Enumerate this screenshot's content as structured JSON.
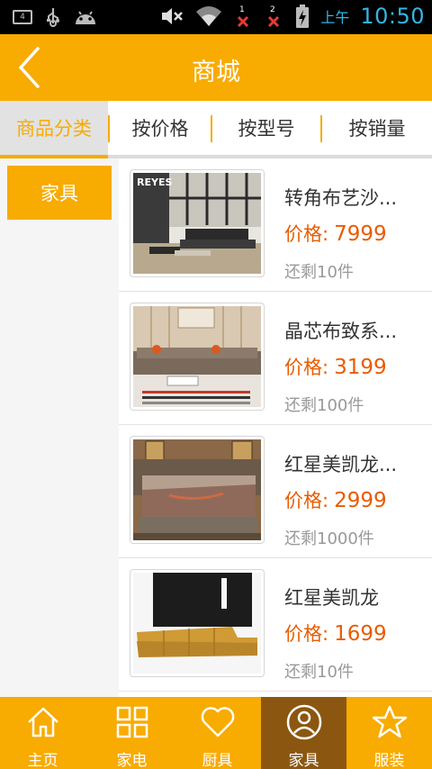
{
  "status_bar": {
    "notification_count": "4",
    "ampm": "上午",
    "time": "10:50",
    "sim1": "1",
    "sim2": "2"
  },
  "header": {
    "title": "商城"
  },
  "tabs": [
    {
      "label": "商品分类",
      "active": true
    },
    {
      "label": "按价格",
      "active": false
    },
    {
      "label": "按型号",
      "active": false
    },
    {
      "label": "按销量",
      "active": false
    }
  ],
  "categories": [
    {
      "label": "家具",
      "active": true
    }
  ],
  "products": [
    {
      "name": "转角布艺沙...",
      "price_label": "价格:",
      "price": "7999",
      "stock": "还剩10件",
      "image_logo": "REYES"
    },
    {
      "name": "晶芯布致系...",
      "price_label": "价格:",
      "price": "3199",
      "stock": "还剩100件"
    },
    {
      "name": "红星美凯龙...",
      "price_label": "价格:",
      "price": "2999",
      "stock": "还剩1000件"
    },
    {
      "name": "红星美凯龙",
      "price_label": "价格:",
      "price": "1699",
      "stock": "还剩10件"
    }
  ],
  "bottom_nav": [
    {
      "label": "主页",
      "icon": "home-icon",
      "active": false
    },
    {
      "label": "家电",
      "icon": "grid-icon",
      "active": false
    },
    {
      "label": "厨具",
      "icon": "heart-icon",
      "active": false
    },
    {
      "label": "家具",
      "icon": "user-icon",
      "active": true
    },
    {
      "label": "服装",
      "icon": "star-icon",
      "active": false
    }
  ],
  "colors": {
    "primary": "#f8ab00",
    "active_nav": "#8b5710",
    "price": "#e85c00",
    "status_time": "#33b5e5"
  }
}
